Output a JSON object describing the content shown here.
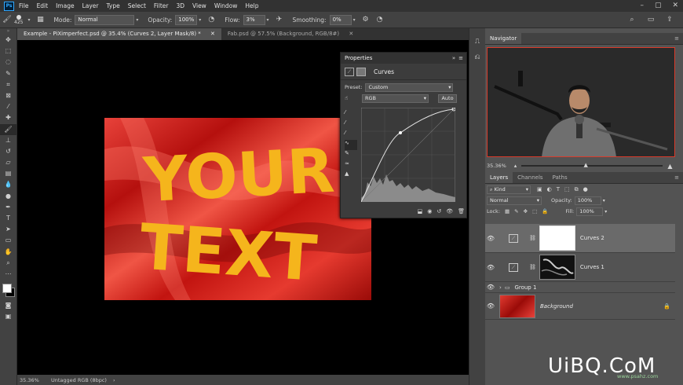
{
  "app": {
    "logo": "Ps",
    "menu": [
      "File",
      "Edit",
      "Image",
      "Layer",
      "Type",
      "Select",
      "Filter",
      "3D",
      "View",
      "Window",
      "Help"
    ],
    "window_controls": [
      "–",
      "▢",
      "✕"
    ]
  },
  "options": {
    "brush_size": "425",
    "mode_label": "Mode:",
    "mode_value": "Normal",
    "opacity_label": "Opacity:",
    "opacity_value": "100%",
    "flow_label": "Flow:",
    "flow_value": "3%",
    "smoothing_label": "Smoothing:",
    "smoothing_value": "0%"
  },
  "tabs": [
    {
      "label": "Example - PiXimperfect.psd @ 35.4% (Curves 2, Layer Mask/8) *",
      "close": "✕"
    },
    {
      "label": "Fab.psd @ 57.5% (Background, RGB/8#)",
      "close": "✕"
    }
  ],
  "artwork": {
    "line1": "YOUR",
    "line2": "TEXT",
    "text_color": "#f5b51c",
    "bg_color": "#d91f1a"
  },
  "status": {
    "zoom": "35.36%",
    "profile": "Untagged RGB (8bpc)",
    "arrow": "›"
  },
  "properties": {
    "title": "Properties",
    "panel_name": "Curves",
    "preset_label": "Preset:",
    "preset_value": "Custom",
    "channel_value": "RGB",
    "auto_label": "Auto"
  },
  "navigator": {
    "title": "Navigator",
    "zoom": "35.36%"
  },
  "layers_panel": {
    "tabs": [
      "Layers",
      "Channels",
      "Paths"
    ],
    "kind_label": "Kind",
    "blend_mode": "Normal",
    "opacity_label": "Opacity:",
    "opacity_value": "100%",
    "lock_label": "Lock:",
    "fill_label": "Fill:",
    "fill_value": "100%",
    "layers": [
      {
        "name": "Curves 2",
        "selected": true
      },
      {
        "name": "Curves 1",
        "selected": false
      },
      {
        "name": "Group 1",
        "selected": false
      },
      {
        "name": "Background",
        "selected": false
      }
    ]
  },
  "watermark": {
    "brand": "UiBQ.CoM",
    "sub": "www.psahz.com"
  }
}
